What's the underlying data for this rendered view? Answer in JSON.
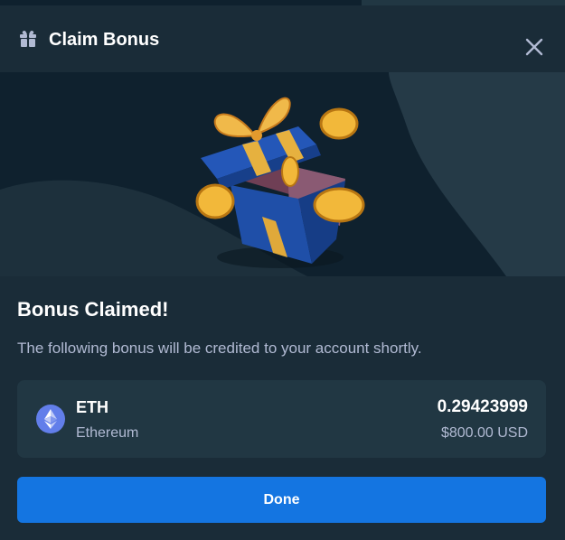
{
  "header": {
    "title": "Claim Bonus",
    "icon": "gift-icon",
    "close_icon": "close-icon"
  },
  "hero": {
    "image": "open-gift-box-with-gold-coins"
  },
  "content": {
    "heading": "Bonus Claimed!",
    "description": "The following bonus will be credited to your account shortly."
  },
  "bonus": {
    "symbol": "ETH",
    "name": "Ethereum",
    "amount": "0.29423999",
    "usd_value": "$800.00 USD",
    "icon": "ethereum-icon"
  },
  "actions": {
    "done_label": "Done"
  },
  "colors": {
    "background": "#1a2c38",
    "hero_background": "#0f212e",
    "card_background": "#213743",
    "primary_button": "#1475e1",
    "text_primary": "#ffffff",
    "text_secondary": "#b1bad3",
    "eth_accent": "#627eea"
  }
}
